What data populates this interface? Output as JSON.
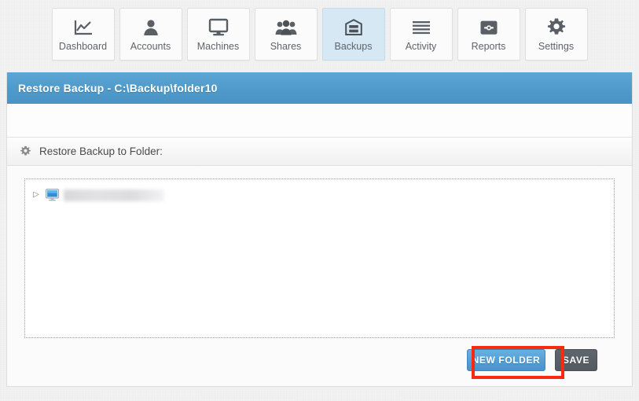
{
  "nav": {
    "tabs": [
      {
        "label": "Dashboard",
        "icon": "chart-line-icon",
        "active": false
      },
      {
        "label": "Accounts",
        "icon": "user-icon",
        "active": false
      },
      {
        "label": "Machines",
        "icon": "monitor-icon",
        "active": false
      },
      {
        "label": "Shares",
        "icon": "users-group-icon",
        "active": false
      },
      {
        "label": "Backups",
        "icon": "archive-icon",
        "active": true
      },
      {
        "label": "Activity",
        "icon": "lines-icon",
        "active": false
      },
      {
        "label": "Reports",
        "icon": "inbox-icon",
        "active": false
      },
      {
        "label": "Settings",
        "icon": "gear-icon",
        "active": false
      }
    ]
  },
  "panel": {
    "header_title": "Restore Backup - C:\\Backup\\folder10",
    "section_label": "Restore Backup to Folder:",
    "section_icon": "gear-icon"
  },
  "tree": {
    "rows": [
      {
        "arrow": "▷",
        "icon": "computer-monitor-icon",
        "label": "",
        "redacted": true
      }
    ]
  },
  "buttons": {
    "new_folder": "NEW FOLDER",
    "save": "SAVE"
  },
  "colors": {
    "header_blue": "#4f9bcb",
    "active_tab": "#d5e8f3",
    "new_folder_blue": "#55a0d6",
    "save_gray": "#545a62",
    "annotation_red": "#fa2a10",
    "page_bg": "#f3f3f3"
  }
}
